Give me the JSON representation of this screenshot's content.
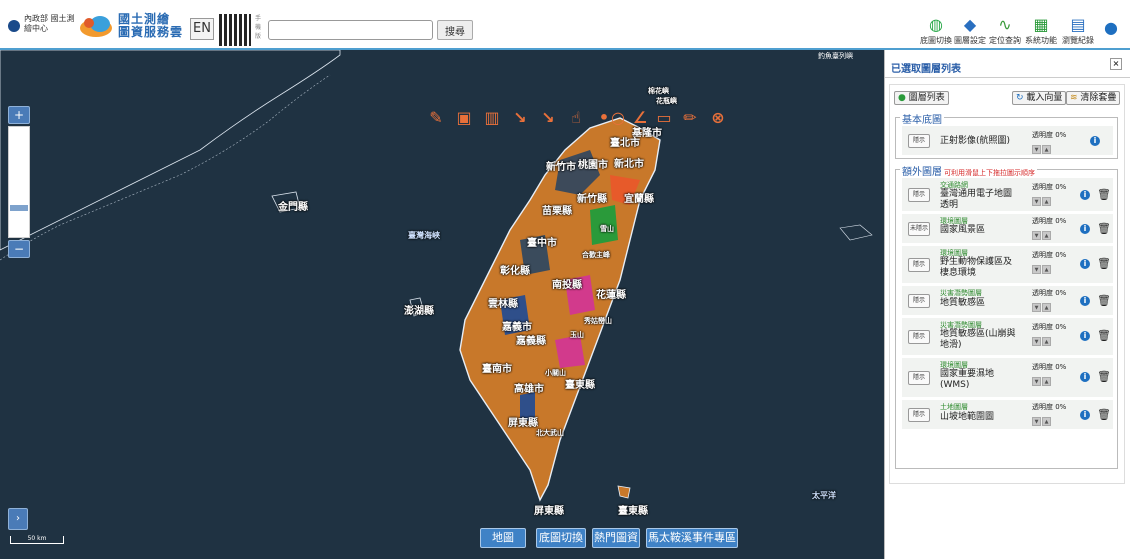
{
  "header": {
    "moi_text": "內政部 國土測繪中心",
    "site_title_line1": "國土測繪",
    "site_title_line2": "圖資服務雲",
    "en_label": "EN",
    "qr_label": "手機版",
    "search_placeholder": "",
    "search_button": "搜尋",
    "tools": [
      {
        "label": "底圖切換",
        "icon": "globe-icon"
      },
      {
        "label": "圖層設定",
        "icon": "layers-icon"
      },
      {
        "label": "定位查詢",
        "icon": "route-icon"
      },
      {
        "label": "系統功能",
        "icon": "calendar-icon"
      },
      {
        "label": "瀏覽紀錄",
        "icon": "document-icon"
      }
    ]
  },
  "map": {
    "zoom_in": "+",
    "zoom_out": "−",
    "expand": "›",
    "scale_label": "50 km",
    "corner_label": "釣魚臺列嶼",
    "labels": [
      {
        "text": "棉花嶼",
        "cls": "small"
      },
      {
        "text": "花瓶嶼",
        "cls": "small"
      },
      {
        "text": "基隆市",
        "cls": ""
      },
      {
        "text": "臺北市",
        "cls": ""
      },
      {
        "text": "新北市",
        "cls": ""
      },
      {
        "text": "桃園市",
        "cls": ""
      },
      {
        "text": "新竹市",
        "cls": ""
      },
      {
        "text": "新竹縣",
        "cls": ""
      },
      {
        "text": "宜蘭縣",
        "cls": ""
      },
      {
        "text": "苗栗縣",
        "cls": ""
      },
      {
        "text": "雪山",
        "cls": "small"
      },
      {
        "text": "金門縣",
        "cls": ""
      },
      {
        "text": "臺灣海峽",
        "cls": "blue"
      },
      {
        "text": "臺中市",
        "cls": ""
      },
      {
        "text": "合歡主峰",
        "cls": "small"
      },
      {
        "text": "彰化縣",
        "cls": ""
      },
      {
        "text": "南投縣",
        "cls": ""
      },
      {
        "text": "花蓮縣",
        "cls": ""
      },
      {
        "text": "雲林縣",
        "cls": ""
      },
      {
        "text": "澎湖縣",
        "cls": ""
      },
      {
        "text": "嘉義市",
        "cls": ""
      },
      {
        "text": "嘉義縣",
        "cls": ""
      },
      {
        "text": "秀姑巒山",
        "cls": "small"
      },
      {
        "text": "玉山",
        "cls": "small"
      },
      {
        "text": "臺南市",
        "cls": ""
      },
      {
        "text": "小關山",
        "cls": "small"
      },
      {
        "text": "高雄市",
        "cls": ""
      },
      {
        "text": "臺東縣",
        "cls": ""
      },
      {
        "text": "屏東縣",
        "cls": ""
      },
      {
        "text": "北大武山",
        "cls": "small"
      },
      {
        "text": "屏東縣",
        "cls": ""
      },
      {
        "text": "臺東縣",
        "cls": ""
      },
      {
        "text": "太平洋",
        "cls": "blue"
      }
    ],
    "bottom_tabs": [
      "地圖",
      "底圖切換",
      "熱門圖資",
      "馬太鞍溪事件專區"
    ]
  },
  "panel": {
    "title": "已選取圖層列表",
    "close": "×",
    "layer_list_btn": "圖層列表",
    "load_btn": "載入向量",
    "clear_btn": "清除套疊",
    "base_legend": "基本底圖",
    "extra_legend": "額外圖層",
    "extra_hint": "可利用滑鼠上下拖拉圖示順序",
    "opacity_label": "透明度 0%",
    "base_layer": {
      "btn": "隱示",
      "name": "正射影像(航照圖)"
    },
    "layers": [
      {
        "btn": "隱示",
        "cat": "交通路網",
        "name": "臺灣通用電子地圖透明"
      },
      {
        "btn": "未隱示",
        "cat": "環境圖層",
        "name": "國家風景區"
      },
      {
        "btn": "隱示",
        "cat": "環境圖層",
        "name": "野生動物保護區及棲息環境"
      },
      {
        "btn": "隱示",
        "cat": "災害潛勢圖層",
        "name": "地質敏感區"
      },
      {
        "btn": "隱示",
        "cat": "災害潛勢圖層",
        "name": "地質敏感區(山崩與地滑)"
      },
      {
        "btn": "隱示",
        "cat": "環境圖層",
        "name": "國家重要濕地(WMS)"
      },
      {
        "btn": "隱示",
        "cat": "土地圖層",
        "name": "山坡地範圍圖"
      }
    ]
  }
}
